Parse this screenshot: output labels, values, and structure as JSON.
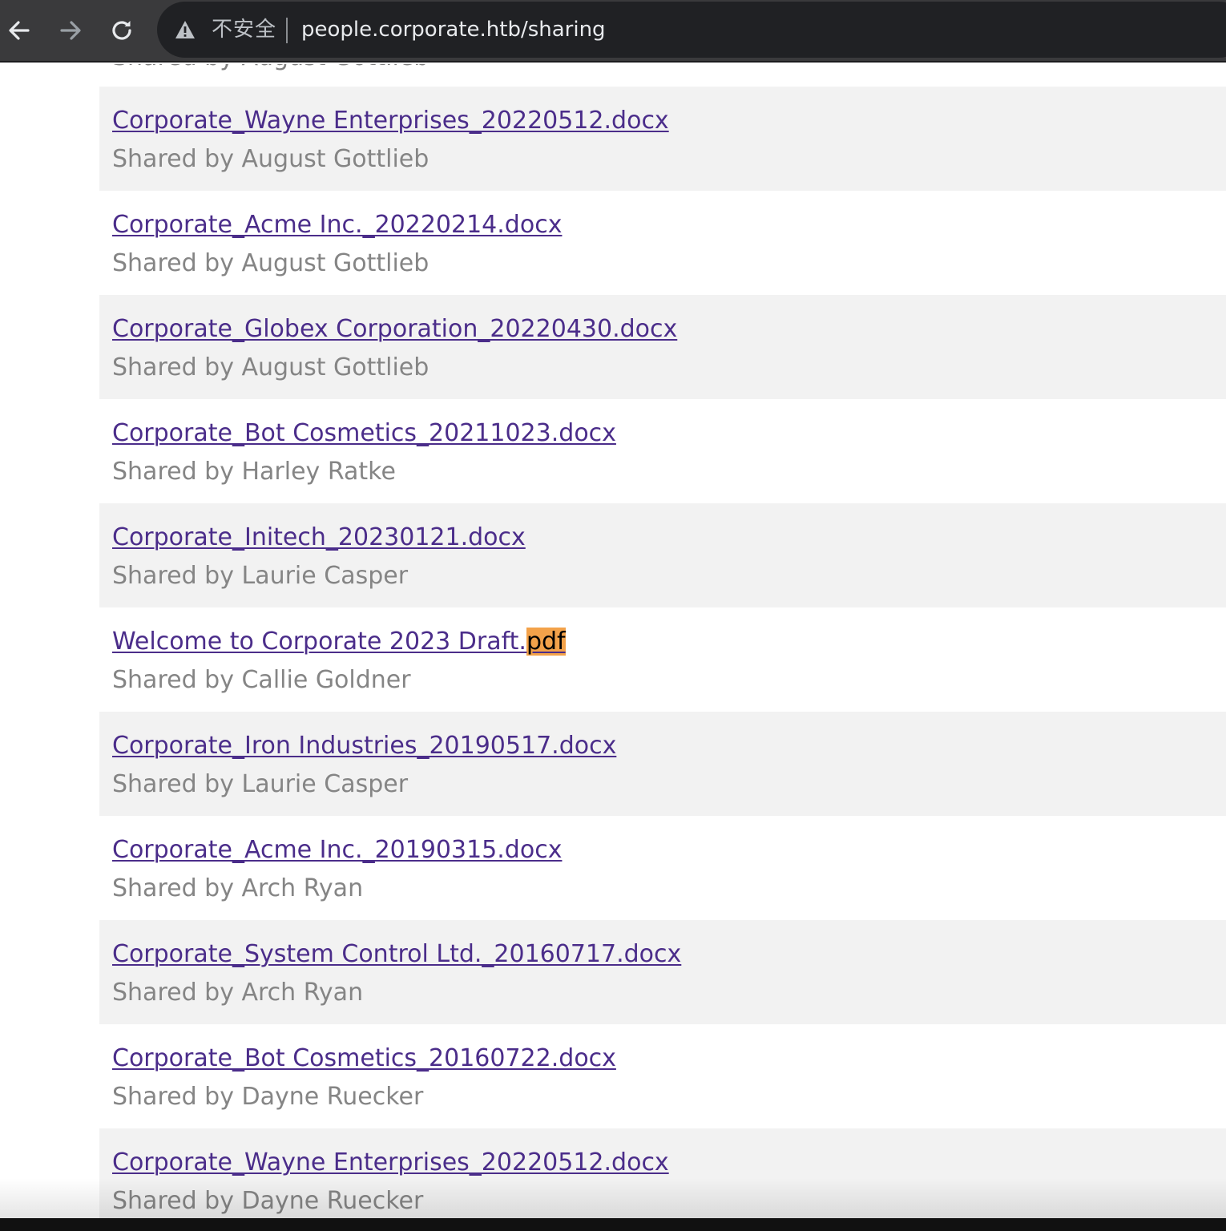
{
  "browser": {
    "back_icon": "arrow-left-icon",
    "forward_icon": "arrow-right-icon",
    "reload_icon": "reload-icon",
    "security_icon": "warning-triangle-icon",
    "security_label": "不安全",
    "url": "people.corporate.htb/sharing",
    "colors": {
      "toolbar": "#3a3a3c",
      "omnibox": "#202124",
      "url_text": "#e8eaed"
    }
  },
  "page": {
    "partial_top_text": "Shared by August Gottlieb",
    "colors": {
      "link": "#4b2d8a",
      "shared_by": "#858585",
      "row_shade": "#f2f2f2",
      "find_highlight": "#f3a24a"
    },
    "files": [
      {
        "name": "Corporate_Wayne Enterprises_20220512.docx",
        "shared_by": "Shared by August Gottlieb"
      },
      {
        "name": "Corporate_Acme Inc._20220214.docx",
        "shared_by": "Shared by August Gottlieb"
      },
      {
        "name": "Corporate_Globex Corporation_20220430.docx",
        "shared_by": "Shared by August Gottlieb"
      },
      {
        "name": "Corporate_Bot Cosmetics_20211023.docx",
        "shared_by": "Shared by Harley Ratke"
      },
      {
        "name": "Corporate_Initech_20230121.docx",
        "shared_by": "Shared by Laurie Casper"
      },
      {
        "name_prefix": "Welcome to Corporate 2023 Draft.",
        "name_highlight": "pdf",
        "shared_by": "Shared by Callie Goldner"
      },
      {
        "name": "Corporate_Iron Industries_20190517.docx",
        "shared_by": "Shared by Laurie Casper"
      },
      {
        "name": "Corporate_Acme Inc._20190315.docx",
        "shared_by": "Shared by Arch Ryan"
      },
      {
        "name": "Corporate_System Control Ltd._20160717.docx",
        "shared_by": "Shared by Arch Ryan"
      },
      {
        "name": "Corporate_Bot Cosmetics_20160722.docx",
        "shared_by": "Shared by Dayne Ruecker"
      },
      {
        "name": "Corporate_Wayne Enterprises_20220512.docx",
        "shared_by": "Shared by Dayne Ruecker"
      }
    ]
  }
}
